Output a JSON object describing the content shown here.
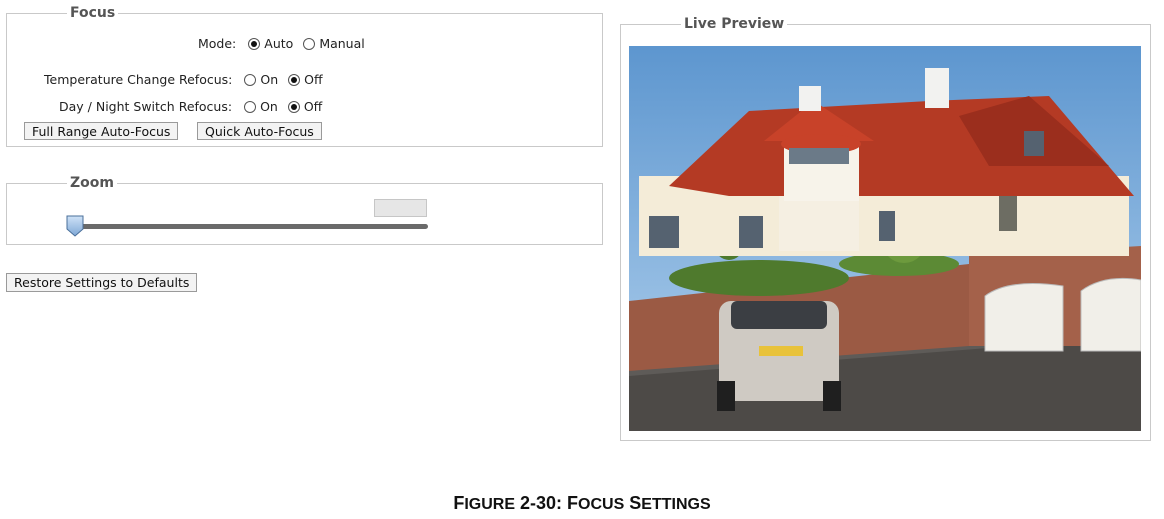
{
  "focus": {
    "legend": "Focus",
    "mode_label": "Mode:",
    "mode_options": [
      {
        "label": "Auto",
        "checked": true
      },
      {
        "label": "Manual",
        "checked": false
      }
    ],
    "temp_label": "Temperature Change Refocus:",
    "temp_options": [
      {
        "label": "On",
        "checked": false
      },
      {
        "label": "Off",
        "checked": true
      }
    ],
    "daynight_label": "Day / Night Switch Refocus:",
    "daynight_options": [
      {
        "label": "On",
        "checked": false
      },
      {
        "label": "Off",
        "checked": true
      }
    ],
    "full_range_button": "Full Range Auto-Focus",
    "quick_button": "Quick Auto-Focus"
  },
  "zoom": {
    "legend": "Zoom",
    "slider_value": 0,
    "value_text": ""
  },
  "restore_button": "Restore Settings to Defaults",
  "preview": {
    "legend": "Live Preview"
  },
  "caption": {
    "prefix_big": "F",
    "prefix_rest": "IGURE",
    "number": " 2-30: ",
    "title_f": "F",
    "title_f_rest": "OCUS",
    "title_s": " S",
    "title_s_rest": "ETTINGS"
  }
}
